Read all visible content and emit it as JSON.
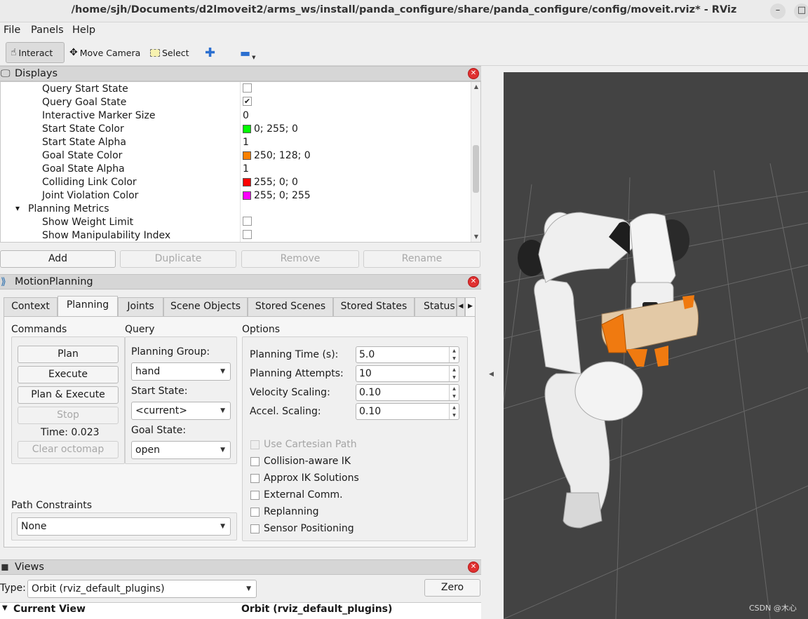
{
  "window": {
    "title": "/home/sjh/Documents/d2lmoveit2/arms_ws/install/panda_configure/share/panda_configure/config/moveit.rviz* - RViz",
    "minimize_glyph": "–",
    "maximize_glyph": "□"
  },
  "menubar": {
    "items": [
      "File",
      "Panels",
      "Help"
    ]
  },
  "toolbar": {
    "interact": "Interact",
    "move_camera": "Move Camera",
    "select": "Select"
  },
  "displays": {
    "title": "Displays",
    "rows": [
      {
        "name": "Query Start State",
        "type": "check",
        "checked": false
      },
      {
        "name": "Query Goal State",
        "type": "check",
        "checked": true
      },
      {
        "name": "Interactive Marker Size",
        "type": "text",
        "value": "0"
      },
      {
        "name": "Start State Color",
        "type": "color",
        "value": "0; 255; 0",
        "color": "#00ff00"
      },
      {
        "name": "Start State Alpha",
        "type": "text",
        "value": "1"
      },
      {
        "name": "Goal State Color",
        "type": "color",
        "value": "250; 128; 0",
        "color": "#fa8000"
      },
      {
        "name": "Goal State Alpha",
        "type": "text",
        "value": "1"
      },
      {
        "name": "Colliding Link Color",
        "type": "color",
        "value": "255; 0; 0",
        "color": "#ff0000"
      },
      {
        "name": "Joint Violation Color",
        "type": "color",
        "value": "255; 0; 255",
        "color": "#ff00ff"
      },
      {
        "name": "Planning Metrics",
        "type": "group"
      },
      {
        "name": "Show Weight Limit",
        "type": "check",
        "checked": false
      },
      {
        "name": "Show Manipulability Index",
        "type": "check",
        "checked": false
      }
    ],
    "buttons": {
      "add": "Add",
      "duplicate": "Duplicate",
      "remove": "Remove",
      "rename": "Rename"
    }
  },
  "motion_planning": {
    "title": "MotionPlanning",
    "tabs": [
      "Context",
      "Planning",
      "Joints",
      "Scene Objects",
      "Stored Scenes",
      "Stored States",
      "Status"
    ],
    "active_tab": "Planning",
    "commands": {
      "label": "Commands",
      "plan": "Plan",
      "execute": "Execute",
      "plan_execute": "Plan & Execute",
      "stop": "Stop",
      "time": "Time: 0.023",
      "clear_octomap": "Clear octomap"
    },
    "query": {
      "label": "Query",
      "planning_group_label": "Planning Group:",
      "planning_group": "hand",
      "start_state_label": "Start State:",
      "start_state": "<current>",
      "goal_state_label": "Goal State:",
      "goal_state": "open"
    },
    "options": {
      "label": "Options",
      "planning_time_label": "Planning Time (s):",
      "planning_time": "5.0",
      "planning_attempts_label": "Planning Attempts:",
      "planning_attempts": "10",
      "velocity_scaling_label": "Velocity Scaling:",
      "velocity_scaling": "0.10",
      "accel_scaling_label": "Accel. Scaling:",
      "accel_scaling": "0.10",
      "use_cartesian_path": "Use Cartesian Path",
      "collision_aware_ik": "Collision-aware IK",
      "approx_ik": "Approx IK Solutions",
      "external_comm": "External Comm.",
      "replanning": "Replanning",
      "sensor_positioning": "Sensor Positioning"
    },
    "path_constraints": {
      "label": "Path Constraints",
      "value": "None"
    }
  },
  "views": {
    "title": "Views",
    "type_label": "Type:",
    "type_value": "Orbit (rviz_default_plugins)",
    "zero": "Zero",
    "current_view": "Current View",
    "current_view_value": "Orbit (rviz_default_plugins)"
  },
  "viewport": {
    "watermark": "CSDN @木心",
    "background": "#434343",
    "grid_color": "#6a6a6a"
  }
}
